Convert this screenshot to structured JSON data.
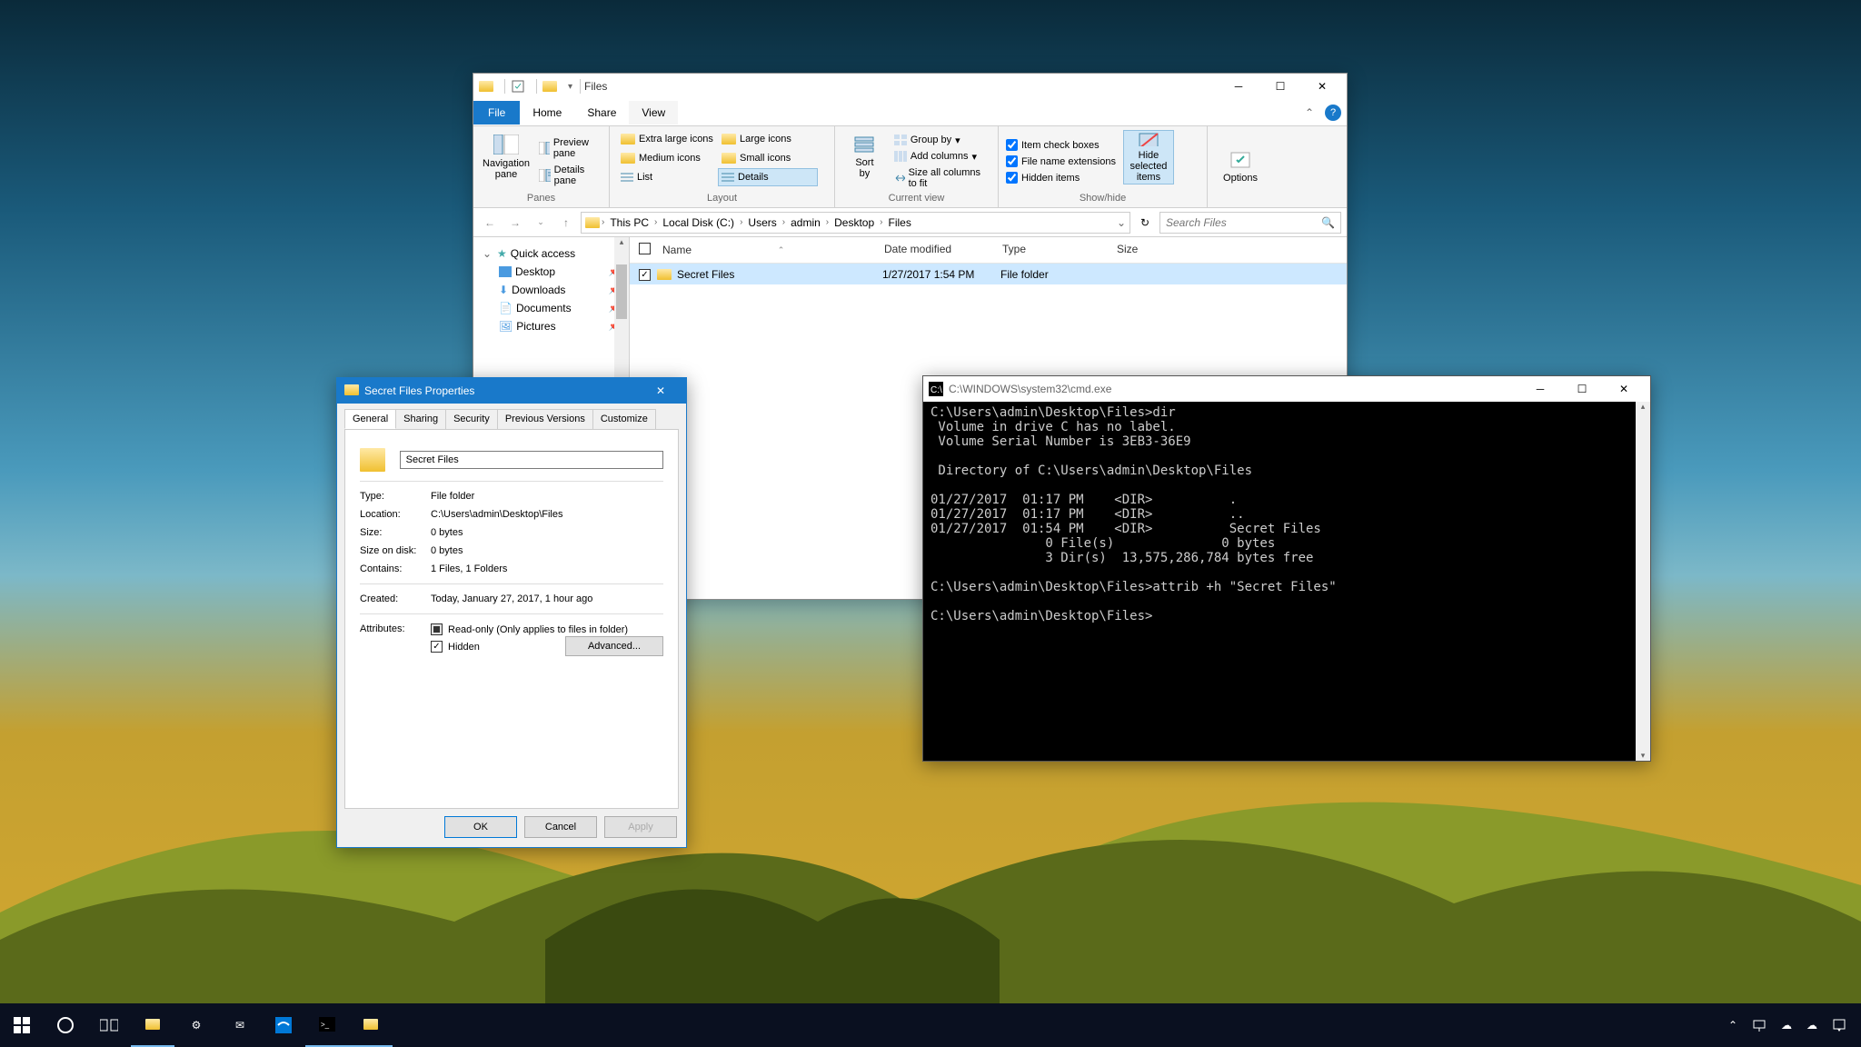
{
  "explorer": {
    "title": "Files",
    "menus": {
      "file": "File",
      "home": "Home",
      "share": "Share",
      "view": "View"
    },
    "ribbon": {
      "panes_label": "Panes",
      "nav_pane": "Navigation\npane",
      "preview": "Preview pane",
      "details": "Details pane",
      "layout_label": "Layout",
      "layouts": {
        "xl": "Extra large icons",
        "lg": "Large icons",
        "md": "Medium icons",
        "sm": "Small icons",
        "list": "List",
        "det": "Details"
      },
      "current_view_label": "Current view",
      "sort": "Sort\nby",
      "group": "Group by",
      "addcol": "Add columns",
      "sizecol": "Size all columns to fit",
      "show_label": "Show/hide",
      "checkboxes": "Item check boxes",
      "extensions": "File name extensions",
      "hidden": "Hidden items",
      "hidesel": "Hide selected\nitems",
      "options": "Options"
    },
    "breadcrumb": [
      "This PC",
      "Local Disk (C:)",
      "Users",
      "admin",
      "Desktop",
      "Files"
    ],
    "search_placeholder": "Search Files",
    "nav": {
      "quick": "Quick access",
      "desktop": "Desktop",
      "downloads": "Downloads",
      "documents": "Documents",
      "pictures": "Pictures"
    },
    "columns": {
      "name": "Name",
      "date": "Date modified",
      "type": "Type",
      "size": "Size"
    },
    "row": {
      "name": "Secret Files",
      "date": "1/27/2017 1:54 PM",
      "type": "File folder"
    }
  },
  "props": {
    "title": "Secret Files Properties",
    "tabs": {
      "general": "General",
      "sharing": "Sharing",
      "security": "Security",
      "prev": "Previous Versions",
      "cust": "Customize"
    },
    "name": "Secret Files",
    "rows": {
      "type_k": "Type:",
      "type_v": "File folder",
      "loc_k": "Location:",
      "loc_v": "C:\\Users\\admin\\Desktop\\Files",
      "size_k": "Size:",
      "size_v": "0 bytes",
      "disk_k": "Size on disk:",
      "disk_v": "0 bytes",
      "cont_k": "Contains:",
      "cont_v": "1 Files, 1 Folders",
      "created_k": "Created:",
      "created_v": "Today, January 27, 2017, 1 hour ago",
      "attr_k": "Attributes:",
      "readonly": "Read-only (Only applies to files in folder)",
      "hidden": "Hidden",
      "advanced": "Advanced..."
    },
    "btns": {
      "ok": "OK",
      "cancel": "Cancel",
      "apply": "Apply"
    }
  },
  "cmd": {
    "title": "C:\\WINDOWS\\system32\\cmd.exe",
    "lines": "C:\\Users\\admin\\Desktop\\Files>dir\n Volume in drive C has no label.\n Volume Serial Number is 3EB3-36E9\n\n Directory of C:\\Users\\admin\\Desktop\\Files\n\n01/27/2017  01:17 PM    <DIR>          .\n01/27/2017  01:17 PM    <DIR>          ..\n01/27/2017  01:54 PM    <DIR>          Secret Files\n               0 File(s)              0 bytes\n               3 Dir(s)  13,575,286,784 bytes free\n\nC:\\Users\\admin\\Desktop\\Files>attrib +h \"Secret Files\"\n\nC:\\Users\\admin\\Desktop\\Files>"
  }
}
